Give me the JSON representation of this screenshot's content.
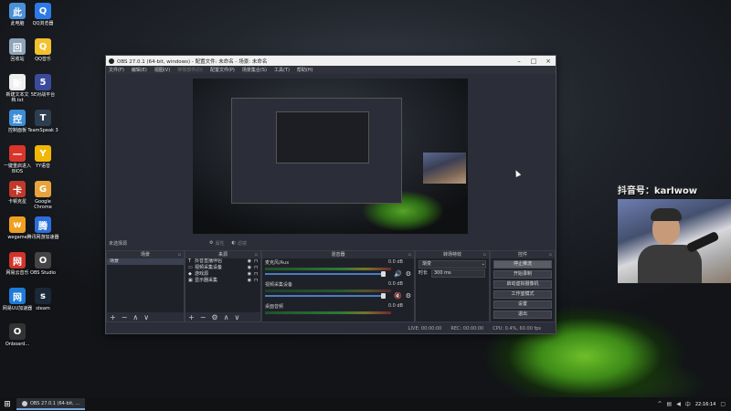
{
  "desktop_icons": [
    {
      "label": "此电脑",
      "icon": "computer-icon",
      "color": "#4a90d9"
    },
    {
      "label": "QQ浏览器",
      "icon": "qq-browser-icon",
      "color": "#2c7be5"
    },
    {
      "label": "回收站",
      "icon": "recycle-bin-icon",
      "color": "#8fa4b8"
    },
    {
      "label": "QQ音乐",
      "icon": "qq-music-icon",
      "color": "#f2c12e"
    },
    {
      "label": "新建文本文档.txt",
      "icon": "text-file-icon",
      "color": "#eeeeee"
    },
    {
      "label": "5E对战平台",
      "icon": "5e-icon",
      "color": "#3a4b9c"
    },
    {
      "label": "控制面板",
      "icon": "control-panel-icon",
      "color": "#3d8ed8"
    },
    {
      "label": "TeamSpeak 3",
      "icon": "teamspeak-icon",
      "color": "#2d3e50"
    },
    {
      "label": "一键重启进入BIOS",
      "icon": "bios-icon",
      "color": "#d9352b"
    },
    {
      "label": "YY语音",
      "icon": "yy-icon",
      "color": "#f2b705"
    },
    {
      "label": "卡顿克星",
      "icon": "booster-icon",
      "color": "#c0392b"
    },
    {
      "label": "Google Chrome",
      "icon": "chrome-icon",
      "color": "#e8a33d"
    },
    {
      "label": "wegame",
      "icon": "wegame-icon",
      "color": "#f0a020"
    },
    {
      "label": "腾讯网游加速器",
      "icon": "tencent-accelerator-icon",
      "color": "#2a6fdb"
    },
    {
      "label": "网易云音乐",
      "icon": "netease-music-icon",
      "color": "#d0342c"
    },
    {
      "label": "OBS Studio",
      "icon": "obs-icon",
      "color": "#444444"
    },
    {
      "label": "网易UU加速器",
      "icon": "uu-icon",
      "color": "#1d7bd8"
    },
    {
      "label": "steam",
      "icon": "steam-icon",
      "color": "#1b2838"
    },
    {
      "label": "Onboard...",
      "icon": "logitech-icon",
      "color": "#333333"
    }
  ],
  "obs": {
    "title": "OBS 27.0.1 (64-bit, windows) - 配置文件: 未命名 - 场景: 未命名",
    "menu": [
      "文件(F)",
      "编辑(E)",
      "视图(V)",
      "停靠部件(D)",
      "配置文件(P)",
      "场景集合(S)",
      "工具(T)",
      "帮助(H)"
    ],
    "source_bar": {
      "label": "未选择源",
      "properties": "属性",
      "filters": "滤镜"
    },
    "scenes": {
      "title": "场景",
      "items": [
        "场景"
      ]
    },
    "sources": {
      "title": "来源",
      "items": [
        "抖音直播伴侣",
        "视频采集设备",
        "游戏源",
        "显示器采集"
      ]
    },
    "mixer": {
      "title": "混音器",
      "channels": [
        {
          "name": "麦克风/Aux",
          "db": "0.0 dB"
        },
        {
          "name": "视频采集设备",
          "db": "0.0 dB"
        },
        {
          "name": "桌面音频",
          "db": "0.0 dB"
        }
      ]
    },
    "transitions": {
      "title": "转场特效",
      "type": "渐变",
      "duration_label": "时长",
      "duration": "300 ms"
    },
    "controls": {
      "title": "控件",
      "buttons": [
        "停止推流",
        "开始录制",
        "启动虚拟摄像机",
        "工作室模式",
        "设置",
        "退出"
      ]
    },
    "status": {
      "live": "LIVE: 00:00:00",
      "rec": "REC: 00:00:00",
      "cpu": "CPU: 0.4%, 60.00 fps"
    }
  },
  "overlay_text": "抖音号：karlwow",
  "taskbar": {
    "task_label": "OBS 27.0.1 (64-bit, ...",
    "clock": "22:16:14"
  }
}
